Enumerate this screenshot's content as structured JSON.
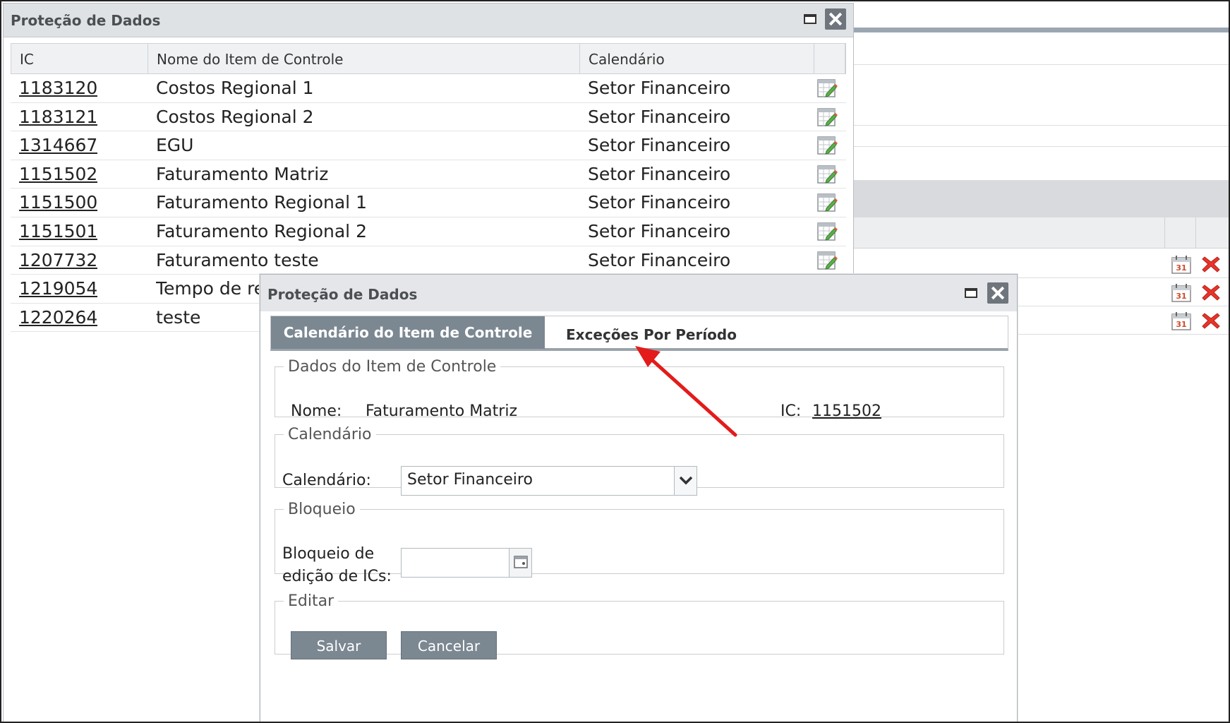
{
  "main_window": {
    "title": "Proteção de Dados",
    "columns": [
      "IC",
      "Nome do Item de Controle",
      "Calendário"
    ],
    "rows": [
      {
        "ic": "1183120",
        "nome": "Costos Regional 1",
        "calendario": "Setor Financeiro"
      },
      {
        "ic": "1183121",
        "nome": "Costos Regional 2",
        "calendario": "Setor Financeiro"
      },
      {
        "ic": "1314667",
        "nome": "EGU",
        "calendario": "Setor Financeiro"
      },
      {
        "ic": "1151502",
        "nome": "Faturamento Matriz",
        "calendario": "Setor Financeiro"
      },
      {
        "ic": "1151500",
        "nome": "Faturamento Regional 1",
        "calendario": "Setor Financeiro"
      },
      {
        "ic": "1151501",
        "nome": "Faturamento Regional 2",
        "calendario": "Setor Financeiro"
      },
      {
        "ic": "1207732",
        "nome": "Faturamento teste",
        "calendario": "Setor Financeiro"
      },
      {
        "ic": "1219054",
        "nome": "Tempo de re",
        "calendario": ""
      },
      {
        "ic": "1220264",
        "nome": "teste",
        "calendario": ""
      }
    ]
  },
  "dialog": {
    "title": "Proteção de Dados",
    "tabs": {
      "active": "Calendário do Item de Controle",
      "other": "Exceções Por Período"
    },
    "dados": {
      "legend": "Dados do Item de Controle",
      "nome_label": "Nome:",
      "nome_value": "Faturamento Matriz",
      "ic_label": "IC:",
      "ic_value": "1151502"
    },
    "calendario": {
      "legend": "Calendário",
      "label": "Calendário:",
      "value": "Setor Financeiro"
    },
    "bloqueio": {
      "legend": "Bloqueio",
      "label_line1": "Bloqueio de",
      "label_line2": "edição de ICs:",
      "value": ""
    },
    "editar": {
      "legend": "Editar",
      "save": "Salvar",
      "cancel": "Cancelar"
    }
  },
  "colors": {
    "accent_gray": "#7b8791",
    "annotation_arrow": "#e31b1b",
    "delete_red": "#e8342a"
  }
}
